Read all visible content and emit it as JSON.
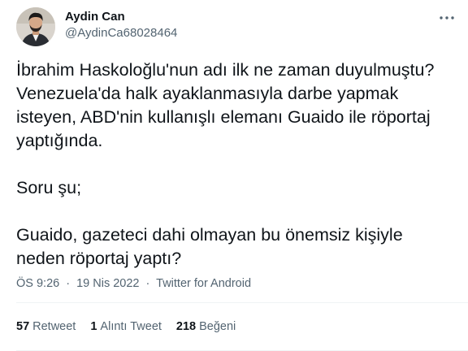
{
  "author": {
    "display_name": "Aydin Can",
    "handle": "@AydinCa68028464"
  },
  "tweet": {
    "text": "İbrahim Haskoloğlu'nun adı ilk ne zaman duyulmuştu?\nVenezuela'da halk ayaklanmasıyla darbe yapmak\nisteyen, ABD'nin kullanışlı elemanı Guaido ile röportaj\nyaptığında.\n\nSoru şu;\n\nGuaido, gazeteci dahi olmayan bu önemsiz kişiyle\nneden röportaj yaptı?"
  },
  "meta": {
    "time": "ÖS 9:26",
    "separator": "·",
    "date": "19 Nis 2022",
    "source": "Twitter for Android"
  },
  "stats": {
    "retweets": {
      "count": "57",
      "label": "Retweet"
    },
    "quotes": {
      "count": "1",
      "label": "Alıntı Tweet"
    },
    "likes": {
      "count": "218",
      "label": "Beğeni"
    }
  },
  "icons": {
    "more": "more-dots-icon"
  },
  "colors": {
    "text": "#0f1419",
    "secondary": "#536471",
    "divider": "#eff3f4"
  }
}
